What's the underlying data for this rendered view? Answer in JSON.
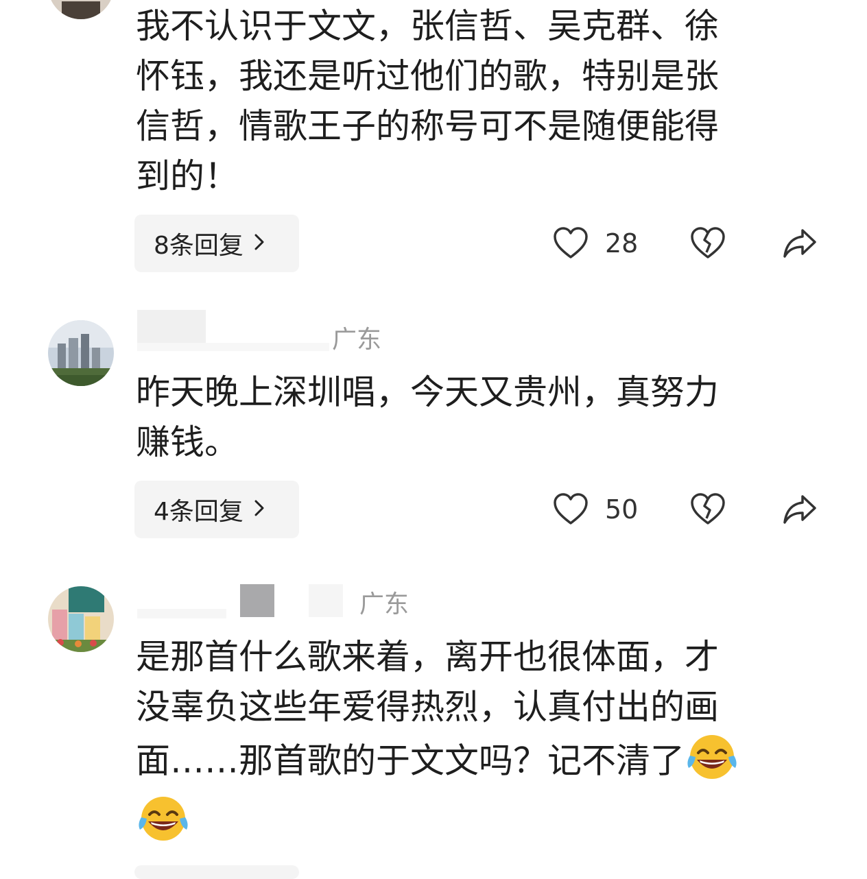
{
  "comments": [
    {
      "text_lines": [
        "我不认识于文文，张信哲、吴克群、徐",
        "怀钰，我还是听过他们的歌，特别是张",
        "信哲，情歌王子的称号可不是随便能得",
        "到的！"
      ],
      "replies_label": "8条回复",
      "likes": "28",
      "avatar_icon": "user-avatar-icon"
    },
    {
      "location": "广东",
      "text_lines": [
        "昨天晚上深圳唱，今天又贵州，真努力",
        "赚钱。"
      ],
      "replies_label": "4条回复",
      "likes": "50",
      "avatar_icon": "city-buildings-avatar-icon"
    },
    {
      "location": "广东",
      "text_lines": [
        "是那首什么歌来着，离开也很体面，才",
        "没辜负这些年爱得热烈，认真付出的画",
        "面……那首歌的于文文吗？记不清了"
      ],
      "emoji": "tears-of-joy-emoji",
      "avatar_icon": "colorful-houses-avatar-icon"
    }
  ],
  "icons": {
    "like": "heart-outline-icon",
    "dislike": "broken-heart-icon",
    "share": "share-arrow-icon",
    "chevron": "chevron-right-icon"
  },
  "colors": {
    "text": "#1e1e1e",
    "muted": "#9a9a9a",
    "reply_bg": "#f4f4f4",
    "icon": "#333333"
  }
}
